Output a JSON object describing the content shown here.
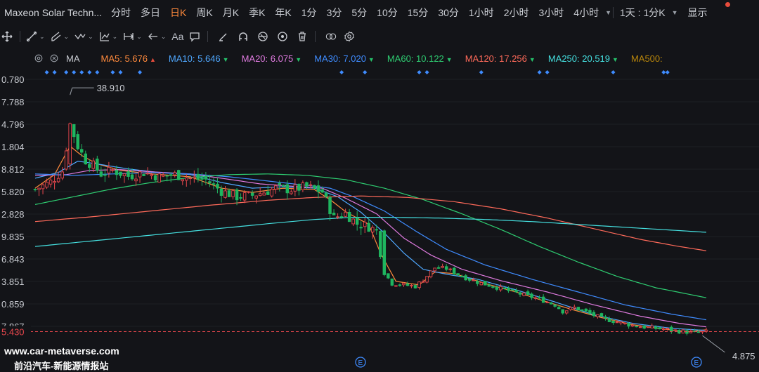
{
  "header": {
    "title": "Maxeon Solar Techn...",
    "timeframes": [
      "分时",
      "多日",
      "日K",
      "周K",
      "月K",
      "季K",
      "年K",
      "1分",
      "3分",
      "5分",
      "10分",
      "15分",
      "30分",
      "1小时",
      "2小时",
      "3小时",
      "4小时"
    ],
    "active_timeframe": "日K",
    "combo": "1天 : 1分K",
    "display_label": "显示"
  },
  "toolbar": {
    "font_label": "Aa"
  },
  "indicators": {
    "label": "MA",
    "items": [
      {
        "text": "MA5:  5.676",
        "color": "#ff8a3c",
        "arrow": "▲",
        "arrow_color": "#e74c3c"
      },
      {
        "text": "MA10:  5.646",
        "color": "#4fa8ff",
        "arrow": "▼",
        "arrow_color": "#26c26b"
      },
      {
        "text": "MA20:  6.075",
        "color": "#e07be0",
        "arrow": "▼",
        "arrow_color": "#26c26b"
      },
      {
        "text": "MA30:  7.020",
        "color": "#3f8cff",
        "arrow": "▼",
        "arrow_color": "#26c26b"
      },
      {
        "text": "MA60:  10.122",
        "color": "#2ecc71",
        "arrow": "▼",
        "arrow_color": "#26c26b"
      },
      {
        "text": "MA120:  17.256",
        "color": "#ff6a5a",
        "arrow": "▼",
        "arrow_color": "#26c26b"
      },
      {
        "text": "MA250:  20.519",
        "color": "#45e0e0",
        "arrow": "▼",
        "arrow_color": "#26c26b"
      },
      {
        "text": "MA500:",
        "color": "#b8860b",
        "arrow": "",
        "arrow_color": "#b8860b"
      }
    ]
  },
  "chart_data": {
    "type": "candlestick",
    "y_ticks": [
      "0.780",
      "7.788",
      "4.796",
      "1.804",
      "8.812",
      "5.820",
      "2.828",
      "9.835",
      "6.843",
      "3.851",
      "0.859",
      "7.867"
    ],
    "current_price": "5.430",
    "current_price_value": 5.43,
    "max_label": "38.910",
    "max_value": 38.91,
    "min_label": "4.875",
    "min_value": 4.875,
    "ylim": [
      3.9,
      41.0
    ],
    "up_color": "#e8474d",
    "down_color": "#1fb55f",
    "close_path": [
      [
        0,
        25.4
      ],
      [
        4,
        26.5
      ],
      [
        7,
        28.0
      ],
      [
        9,
        34.6
      ],
      [
        11,
        31.5
      ],
      [
        13,
        29.5
      ],
      [
        15,
        28.8
      ],
      [
        17,
        27.6
      ],
      [
        20,
        28.1
      ],
      [
        24,
        27.3
      ],
      [
        28,
        27.8
      ],
      [
        32,
        27.2
      ],
      [
        36,
        27.5
      ],
      [
        40,
        27.0
      ],
      [
        44,
        26.8
      ],
      [
        48,
        25.2
      ],
      [
        52,
        24.4
      ],
      [
        56,
        24.6
      ],
      [
        60,
        25.2
      ],
      [
        62,
        25.6
      ],
      [
        66,
        25.4
      ],
      [
        70,
        25.8
      ],
      [
        74,
        25.1
      ],
      [
        77,
        21.4
      ],
      [
        80,
        22.1
      ],
      [
        83,
        20.6
      ],
      [
        86,
        20.2
      ],
      [
        88,
        19.6
      ],
      [
        90,
        13.7
      ],
      [
        92,
        12.2
      ],
      [
        95,
        12.0
      ],
      [
        98,
        11.8
      ],
      [
        100,
        12.7
      ],
      [
        103,
        14.4
      ],
      [
        106,
        14.3
      ],
      [
        110,
        13.2
      ],
      [
        114,
        12.4
      ],
      [
        118,
        11.8
      ],
      [
        122,
        11.2
      ],
      [
        126,
        10.6
      ],
      [
        130,
        10.0
      ],
      [
        134,
        9.2
      ],
      [
        136,
        8.3
      ],
      [
        139,
        8.8
      ],
      [
        142,
        8.2
      ],
      [
        146,
        7.3
      ],
      [
        150,
        6.8
      ],
      [
        154,
        6.3
      ],
      [
        158,
        6.0
      ],
      [
        162,
        5.8
      ],
      [
        166,
        5.5
      ],
      [
        170,
        5.3
      ],
      [
        173,
        5.4
      ]
    ],
    "ma_lines": [
      {
        "name": "MA5",
        "color": "#ff8a3c",
        "pts": [
          [
            0,
            25.6
          ],
          [
            5,
            27.5
          ],
          [
            9,
            31.5
          ],
          [
            12,
            30.2
          ],
          [
            16,
            29.0
          ],
          [
            22,
            28.1
          ],
          [
            30,
            27.6
          ],
          [
            40,
            27.2
          ],
          [
            48,
            25.6
          ],
          [
            56,
            25.0
          ],
          [
            64,
            25.6
          ],
          [
            72,
            25.4
          ],
          [
            76,
            24.0
          ],
          [
            80,
            22.3
          ],
          [
            86,
            20.5
          ],
          [
            89,
            16.5
          ],
          [
            93,
            12.5
          ],
          [
            99,
            12.0
          ],
          [
            103,
            13.8
          ],
          [
            108,
            13.6
          ],
          [
            116,
            12.2
          ],
          [
            124,
            11.0
          ],
          [
            132,
            9.6
          ],
          [
            138,
            8.6
          ],
          [
            146,
            7.4
          ],
          [
            154,
            6.4
          ],
          [
            162,
            5.8
          ],
          [
            168,
            5.4
          ],
          [
            173,
            5.7
          ]
        ]
      },
      {
        "name": "MA10",
        "color": "#4fa8ff",
        "pts": [
          [
            0,
            27.0
          ],
          [
            6,
            27.8
          ],
          [
            11,
            29.4
          ],
          [
            16,
            29.0
          ],
          [
            24,
            28.3
          ],
          [
            32,
            27.8
          ],
          [
            40,
            27.5
          ],
          [
            48,
            26.4
          ],
          [
            56,
            25.6
          ],
          [
            64,
            25.8
          ],
          [
            72,
            25.6
          ],
          [
            78,
            24.4
          ],
          [
            84,
            22.2
          ],
          [
            90,
            19.3
          ],
          [
            95,
            16.5
          ],
          [
            100,
            14.2
          ],
          [
            106,
            13.5
          ],
          [
            114,
            12.8
          ],
          [
            124,
            11.3
          ],
          [
            134,
            9.6
          ],
          [
            144,
            7.8
          ],
          [
            154,
            6.6
          ],
          [
            164,
            5.9
          ],
          [
            173,
            5.6
          ]
        ]
      },
      {
        "name": "MA20",
        "color": "#e07be0",
        "pts": [
          [
            0,
            27.4
          ],
          [
            8,
            27.5
          ],
          [
            14,
            28.1
          ],
          [
            22,
            28.2
          ],
          [
            30,
            27.9
          ],
          [
            40,
            27.6
          ],
          [
            48,
            27.0
          ],
          [
            58,
            26.2
          ],
          [
            68,
            25.8
          ],
          [
            74,
            25.6
          ],
          [
            80,
            24.2
          ],
          [
            88,
            22.0
          ],
          [
            95,
            18.6
          ],
          [
            102,
            16.2
          ],
          [
            110,
            14.2
          ],
          [
            120,
            12.6
          ],
          [
            132,
            11.0
          ],
          [
            144,
            9.2
          ],
          [
            156,
            7.6
          ],
          [
            166,
            6.6
          ],
          [
            173,
            6.1
          ]
        ]
      },
      {
        "name": "MA30",
        "color": "#3f8cff",
        "pts": [
          [
            0,
            27.6
          ],
          [
            10,
            27.4
          ],
          [
            20,
            27.6
          ],
          [
            30,
            27.8
          ],
          [
            40,
            27.6
          ],
          [
            50,
            27.2
          ],
          [
            60,
            26.6
          ],
          [
            70,
            26.0
          ],
          [
            76,
            25.6
          ],
          [
            82,
            24.4
          ],
          [
            90,
            22.4
          ],
          [
            98,
            19.6
          ],
          [
            106,
            17.0
          ],
          [
            116,
            14.8
          ],
          [
            128,
            12.8
          ],
          [
            140,
            11.0
          ],
          [
            152,
            9.2
          ],
          [
            164,
            7.9
          ],
          [
            173,
            7.1
          ]
        ]
      },
      {
        "name": "MA60",
        "color": "#2ecc71",
        "pts": [
          [
            0,
            23.3
          ],
          [
            10,
            24.4
          ],
          [
            20,
            25.5
          ],
          [
            30,
            26.4
          ],
          [
            40,
            27.1
          ],
          [
            50,
            27.5
          ],
          [
            60,
            27.6
          ],
          [
            70,
            27.4
          ],
          [
            80,
            26.8
          ],
          [
            90,
            25.6
          ],
          [
            100,
            24.0
          ],
          [
            110,
            22.0
          ],
          [
            120,
            19.8
          ],
          [
            130,
            17.4
          ],
          [
            140,
            15.2
          ],
          [
            150,
            13.2
          ],
          [
            160,
            11.6
          ],
          [
            173,
            10.2
          ]
        ]
      },
      {
        "name": "MA120",
        "color": "#ff6a5a",
        "pts": [
          [
            0,
            20.9
          ],
          [
            15,
            21.6
          ],
          [
            30,
            22.4
          ],
          [
            45,
            23.2
          ],
          [
            60,
            23.9
          ],
          [
            72,
            24.3
          ],
          [
            84,
            24.5
          ],
          [
            96,
            24.3
          ],
          [
            108,
            23.7
          ],
          [
            120,
            22.7
          ],
          [
            132,
            21.4
          ],
          [
            144,
            19.9
          ],
          [
            156,
            18.4
          ],
          [
            166,
            17.4
          ],
          [
            173,
            16.8
          ]
        ]
      },
      {
        "name": "MA250",
        "color": "#45e0e0",
        "pts": [
          [
            0,
            17.4
          ],
          [
            15,
            18.2
          ],
          [
            30,
            19.0
          ],
          [
            45,
            19.8
          ],
          [
            60,
            20.6
          ],
          [
            72,
            21.2
          ],
          [
            82,
            21.5
          ],
          [
            92,
            21.5
          ],
          [
            104,
            21.4
          ],
          [
            116,
            21.2
          ],
          [
            128,
            20.9
          ],
          [
            140,
            20.5
          ],
          [
            152,
            20.1
          ],
          [
            164,
            19.7
          ],
          [
            173,
            19.4
          ]
        ]
      }
    ]
  }
}
